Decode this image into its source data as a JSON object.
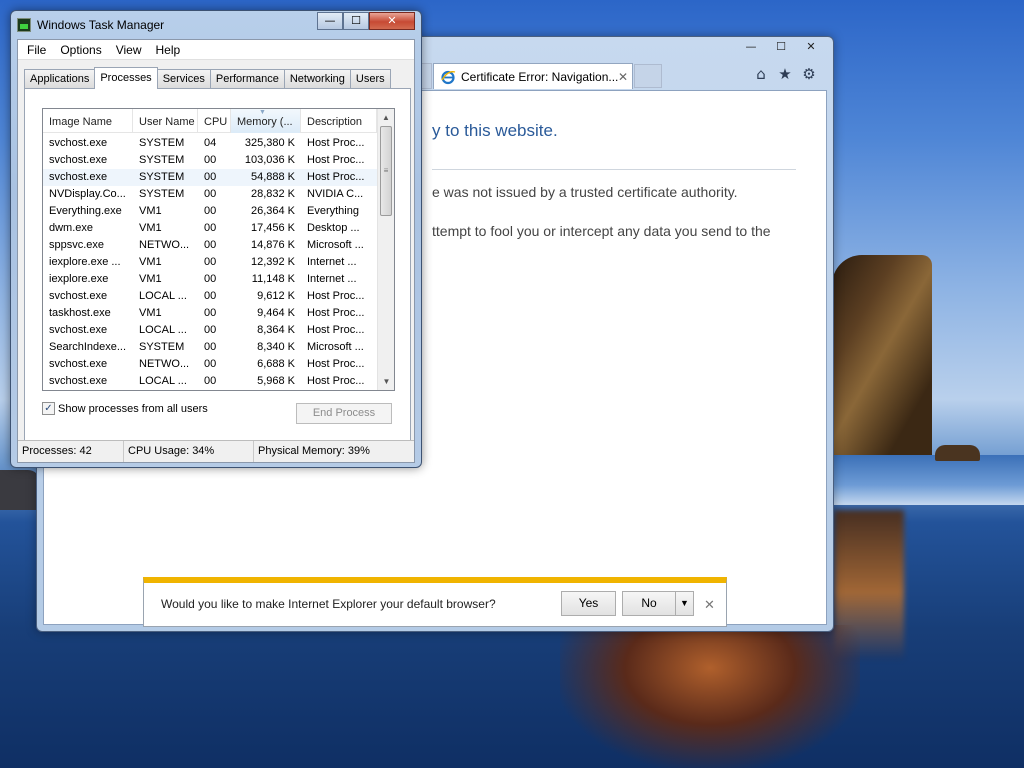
{
  "ie": {
    "tab_title": "Certificate Error: Navigation...",
    "tab_close": "✕",
    "controls": {
      "minimize": "—",
      "maximize": "☐",
      "close": "✕"
    },
    "toolbar": {
      "home": "⌂",
      "favorites": "★",
      "tools": "⚙"
    },
    "content": {
      "heading": "y to this website.",
      "line1": "e was not issued by a trusted certificate authority.",
      "line2": "ttempt to fool you or intercept any data you send to the"
    }
  },
  "default_bar": {
    "message": "Would you like to make Internet Explorer your default browser?",
    "yes": "Yes",
    "no": "No",
    "dropdown": "▼",
    "close": "✕"
  },
  "task_manager": {
    "title": "Windows Task Manager",
    "controls": {
      "minimize": "—",
      "maximize": "☐",
      "close": "✕"
    },
    "menu": [
      "File",
      "Options",
      "View",
      "Help"
    ],
    "tabs": [
      "Applications",
      "Processes",
      "Services",
      "Performance",
      "Networking",
      "Users"
    ],
    "active_tab": "Processes",
    "columns": [
      "Image Name",
      "User Name",
      "CPU",
      "Memory (...",
      "Description"
    ],
    "sorted_column": "Memory (...",
    "processes": [
      {
        "name": "svchost.exe",
        "user": "SYSTEM",
        "cpu": "04",
        "mem": "325,380 K",
        "desc": "Host Proc..."
      },
      {
        "name": "svchost.exe",
        "user": "SYSTEM",
        "cpu": "00",
        "mem": "103,036 K",
        "desc": "Host Proc..."
      },
      {
        "name": "svchost.exe",
        "user": "SYSTEM",
        "cpu": "00",
        "mem": "54,888 K",
        "desc": "Host Proc..."
      },
      {
        "name": "NVDisplay.Co...",
        "user": "SYSTEM",
        "cpu": "00",
        "mem": "28,832 K",
        "desc": "NVIDIA C..."
      },
      {
        "name": "Everything.exe",
        "user": "VM1",
        "cpu": "00",
        "mem": "26,364 K",
        "desc": "Everything"
      },
      {
        "name": "dwm.exe",
        "user": "VM1",
        "cpu": "00",
        "mem": "17,456 K",
        "desc": "Desktop ..."
      },
      {
        "name": "sppsvc.exe",
        "user": "NETWO...",
        "cpu": "00",
        "mem": "14,876 K",
        "desc": "Microsoft ..."
      },
      {
        "name": "iexplore.exe ...",
        "user": "VM1",
        "cpu": "00",
        "mem": "12,392 K",
        "desc": "Internet ..."
      },
      {
        "name": "iexplore.exe",
        "user": "VM1",
        "cpu": "00",
        "mem": "11,148 K",
        "desc": "Internet ..."
      },
      {
        "name": "svchost.exe",
        "user": "LOCAL ...",
        "cpu": "00",
        "mem": "9,612 K",
        "desc": "Host Proc..."
      },
      {
        "name": "taskhost.exe",
        "user": "VM1",
        "cpu": "00",
        "mem": "9,464 K",
        "desc": "Host Proc..."
      },
      {
        "name": "svchost.exe",
        "user": "LOCAL ...",
        "cpu": "00",
        "mem": "8,364 K",
        "desc": "Host Proc..."
      },
      {
        "name": "SearchIndexe...",
        "user": "SYSTEM",
        "cpu": "00",
        "mem": "8,340 K",
        "desc": "Microsoft ..."
      },
      {
        "name": "svchost.exe",
        "user": "NETWO...",
        "cpu": "00",
        "mem": "6,688 K",
        "desc": "Host Proc..."
      },
      {
        "name": "svchost.exe",
        "user": "LOCAL ...",
        "cpu": "00",
        "mem": "5,968 K",
        "desc": "Host Proc..."
      }
    ],
    "selected_row": 2,
    "show_all_label": "Show processes from all users",
    "show_all_checked": true,
    "end_process": "End Process",
    "status": {
      "processes": "Processes: 42",
      "cpu": "CPU Usage: 34%",
      "memory": "Physical Memory: 39%"
    }
  }
}
